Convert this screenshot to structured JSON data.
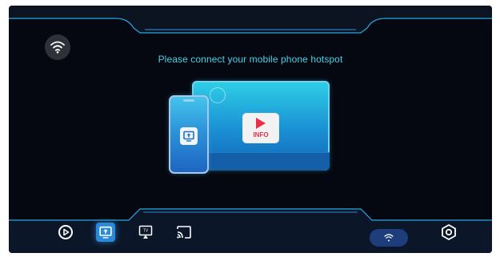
{
  "header": {
    "message": "Please connect your mobile phone hotspot",
    "wifi_status_icon": "wifi-icon"
  },
  "illustration": {
    "tv_card_label": "INFO",
    "tv_card_icon": "play-icon",
    "phone_app_icon": "screen-mirror-icon"
  },
  "bottom_nav": {
    "items": [
      {
        "name": "play-store-icon",
        "active": false
      },
      {
        "name": "screen-mirror-icon",
        "active": true
      },
      {
        "name": "tv-airplay-icon",
        "active": false
      },
      {
        "name": "cast-icon",
        "active": false
      }
    ],
    "wifi_button_icon": "wifi-icon",
    "settings_icon": "settings-hexagon-icon"
  },
  "colors": {
    "background": "#050810",
    "accent": "#45d2e6",
    "active": "#2b8ad8",
    "info_red": "#e8304a"
  }
}
